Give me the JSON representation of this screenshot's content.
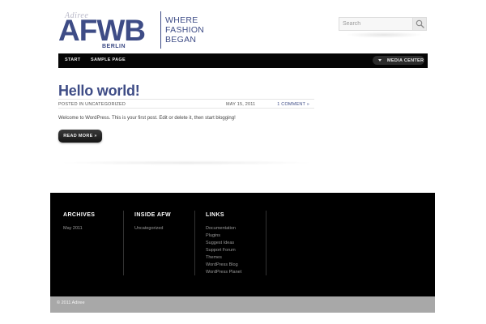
{
  "header": {
    "brand_script": "Adiree",
    "brand_letters": "AFWB",
    "brand_city": "BERLIN",
    "tagline": [
      "WHERE",
      "FASHION",
      "BEGAN"
    ],
    "search": {
      "placeholder": "Search",
      "icon": "magnifier-icon"
    }
  },
  "nav": {
    "items": [
      "START",
      "SAMPLE PAGE"
    ],
    "media_center": "MEDIA CENTER"
  },
  "post": {
    "title": "Hello world!",
    "category_line": "POSTED IN UNCATEGORIZED",
    "date": "MAY 15, 2011",
    "comments": "1 COMMENT »",
    "excerpt": "Welcome to WordPress. This is your first post. Edit or delete it, then start blogging!",
    "read_more": "READ MORE »"
  },
  "footer": {
    "widgets": [
      {
        "title": "ARCHIVES",
        "links": [
          "May 2011"
        ]
      },
      {
        "title": "INSIDE AFW",
        "links": [
          "Uncategorized"
        ]
      },
      {
        "title": "LINKS",
        "links": [
          "Documentation",
          "Plugins",
          "Suggest Ideas",
          "Support Forum",
          "Themes",
          "WordPress Blog",
          "WordPress Planet"
        ]
      }
    ],
    "copyright": "© 2011 Adiree"
  },
  "colors": {
    "brand": "#3e4c86",
    "nav_bg": "#050505",
    "footer_bg": "#000000",
    "copyright_bg": "#a8a8a8"
  }
}
